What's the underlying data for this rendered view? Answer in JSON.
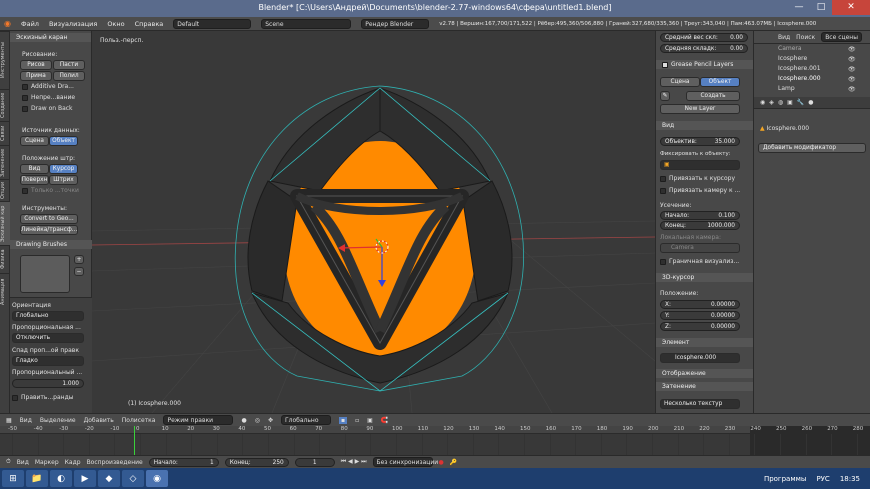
{
  "window": {
    "title": "Blender* [C:\\Users\\Андрей\\Documents\\blender-2.77-windows64\\сфера\\untitled1.blend]",
    "minimize": "—",
    "maximize": "□",
    "close": "✕"
  },
  "menubar": {
    "menus": [
      "Файл",
      "Визуализация",
      "Окно",
      "Справка"
    ],
    "layout": "Default",
    "scene": "Scene",
    "engine": "Рендер Blender",
    "stats": "v2.78 | Вершин:167,700/171,522 | Рёбер:495,360/506,880 | Граней:327,680/335,360 | Треуг:343,040 | Пам:463.07МБ | Icosphere.000"
  },
  "tabs_left": [
    "Инструменты",
    "Создание",
    "Связи",
    "Затенение",
    "Опции",
    "Эскизный кар",
    "Физика",
    "Анимация"
  ],
  "toolshelf": {
    "panel_grease": "Эскизный каран",
    "draw_label": "Рисование:",
    "draw_btn": "Рисов",
    "erase_btn": "Пасти",
    "line_btn": "Прима",
    "poly_btn": "Полил",
    "additive": "Additive Dra...",
    "continuous": "Непре...вание",
    "draw_on_back": "Draw on Back",
    "data_source": "Источник данных:",
    "scene_btn": "Сцена",
    "object_btn": "Объект",
    "stroke_place": "Положение штр:",
    "view_btn": "Вид",
    "cursor_btn": "Курсор",
    "surface_btn": "Поверхн",
    "stroke_btn": "Штрих",
    "only_sel": "Только ...точки",
    "tools_label": "Инструменты:",
    "convert_btn": "Convert to Geo...",
    "ruler_btn": "Линейка/трансф...",
    "panel_brushes": "Drawing Brushes",
    "orientation_label": "Ориентация",
    "orientation_value": "Глобально",
    "proportional_label": "Пропорциональная ...",
    "proportional_value": "Отключить",
    "falloff_label": "Спад проп...ой правк",
    "falloff_value": "Гладко",
    "prop_size_label": "Пропорциональный ...",
    "prop_size_value": "1.000",
    "edit_label": "Править...ранды"
  },
  "viewport": {
    "view_label": "Польз.-персп.",
    "object_label": "(1) Icosphere.000"
  },
  "properties": {
    "avg_weight_label": "Средний вес скл:",
    "avg_weight_value": "0.00",
    "avg_crease_label": "Средняя складк:",
    "avg_crease_value": "0.00",
    "grease_layers": "Grease Pencil Layers",
    "scene_btn": "Сцена",
    "object_btn": "Объект",
    "create_btn": "Создать",
    "new_layer_btn": "New Layer",
    "view_panel": "Вид",
    "lens_label": "Объектив:",
    "lens_value": "35.000",
    "lock_label": "Фиксировать к объекту:",
    "lock_cursor": "Привязать к курсору",
    "lock_camera": "Привязать камеру к ...",
    "clip_label": "Усечение:",
    "clip_start_label": "Начало:",
    "clip_start_value": "0.100",
    "clip_end_label": "Конец:",
    "clip_end_value": "1000.000",
    "local_camera_label": "Локальная камера:",
    "camera_value": "Camera",
    "render_border": "Граничная визуализ...",
    "cursor_panel": "3D-курсор",
    "location_label": "Положение:",
    "x_label": "X:",
    "x_value": "0.00000",
    "y_label": "Y:",
    "y_value": "0.00000",
    "z_label": "Z:",
    "z_value": "0.00000",
    "item_panel": "Элемент",
    "item_value": "Icosphere.000",
    "display_panel": "Отображение",
    "shading_panel": "Затенение",
    "shading_value": "Несколько текстур"
  },
  "outliner": {
    "view_btn": "Вид",
    "search_btn": "Поиск",
    "all_scenes": "Все сцены",
    "items": [
      "Camera",
      "Icosphere",
      "Icosphere.001",
      "Icosphere.000",
      "Lamp"
    ],
    "active_object": "Icosphere.000",
    "add_modifier": "Добавить модификатор"
  },
  "viewport_header": {
    "view": "Вид",
    "select": "Выделение",
    "add": "Добавить",
    "mesh": "Полисетка",
    "mode": "Режим правки",
    "orientation": "Глобально"
  },
  "timeline": {
    "ticks": [
      "-50",
      "-40",
      "-30",
      "-20",
      "-10",
      "0",
      "10",
      "20",
      "30",
      "40",
      "50",
      "60",
      "70",
      "80",
      "90",
      "100",
      "110",
      "120",
      "130",
      "140",
      "150",
      "160",
      "170",
      "180",
      "190",
      "200",
      "210",
      "220",
      "230",
      "240",
      "250",
      "260",
      "270",
      "280"
    ]
  },
  "timeline_header": {
    "view": "Вид",
    "marker": "Маркер",
    "frame": "Кадр",
    "playback": "Воспроизведение",
    "start_label": "Начало:",
    "start_value": "1",
    "end_label": "Конец:",
    "end_value": "250",
    "current_value": "1",
    "sync": "Без синхронизации"
  },
  "taskbar": {
    "programs": "Программы",
    "lang": "РУС",
    "time": "18:35"
  },
  "colors": {
    "orange": "#ff8a00",
    "accent_blue": "#5680c2",
    "title_bar": "#5a6b8c",
    "taskbar": "#1e3e6e"
  }
}
